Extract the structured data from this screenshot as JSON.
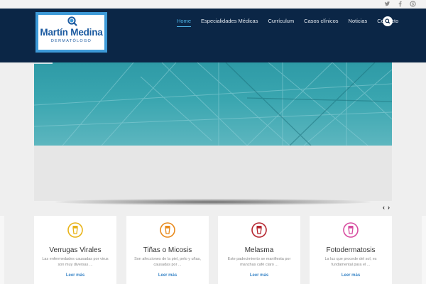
{
  "social": {
    "icons": [
      "twitter-icon",
      "facebook-icon",
      "skype-icon"
    ]
  },
  "logo": {
    "name": "Martín Medina",
    "subtitle": "DERMATÓLOGO"
  },
  "nav": {
    "items": [
      {
        "label": "Home",
        "active": true
      },
      {
        "label": "Especialidades Médicas",
        "active": false
      },
      {
        "label": "Currículum",
        "active": false
      },
      {
        "label": "Casos clínicos",
        "active": false
      },
      {
        "label": "Noticias",
        "active": false
      },
      {
        "label": "Contacto",
        "active": false
      }
    ]
  },
  "slider": {
    "prev": "‹",
    "next": "›"
  },
  "cards": [
    {
      "title": "Verrugas Virales",
      "text": "Las enfermedades causadas por virus son muy diversas ...",
      "link": "Leer más",
      "color": "#e8b318"
    },
    {
      "title": "Tiñas o Micosis",
      "text": "Son afecciones de la piel, pelo y uñas, causadas por ...",
      "link": "Leer más",
      "color": "#e88a1d"
    },
    {
      "title": "Melasma",
      "text": "Este padecimiento se manifiesta por manchas café claro ...",
      "link": "Leer más",
      "color": "#b5242e"
    },
    {
      "title": "Fotodermatosis",
      "text": "La luz que procede del sol, es fundamental para el ...",
      "link": "Leer más",
      "color": "#d74ca0"
    }
  ],
  "colors": {
    "header": "#0b2646",
    "accent": "#4db3e6",
    "link": "#3c87c8"
  }
}
